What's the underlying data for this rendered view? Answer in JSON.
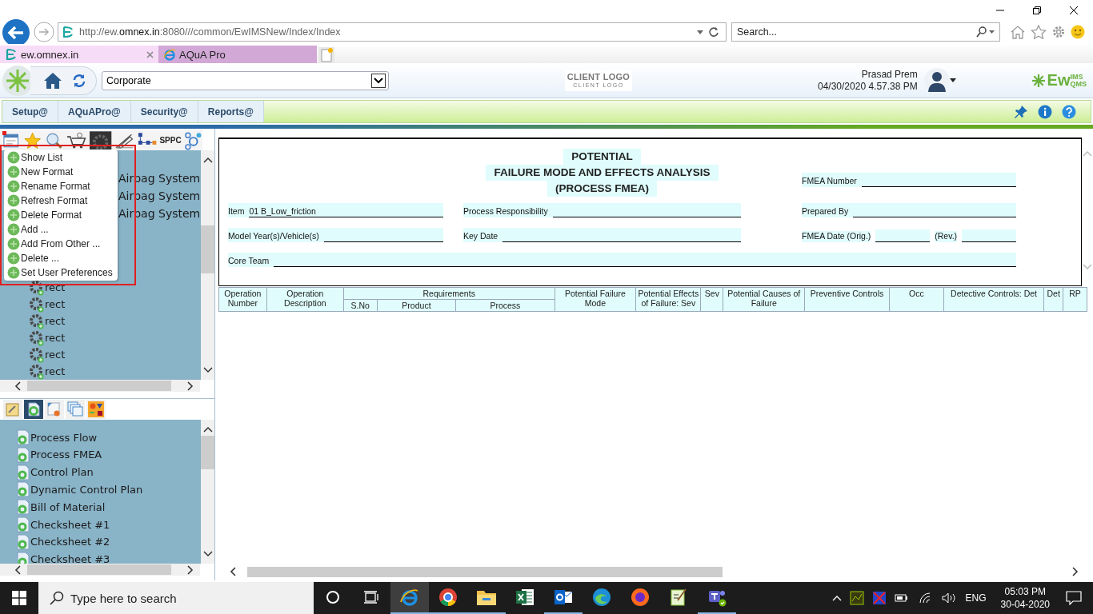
{
  "browser": {
    "url": "http://ew.**omnex.in**:8080///common/EwIMSNew/Index/Index",
    "search": {
      "placeholder": "Search..."
    },
    "tabs": [
      {
        "label": "ew.omnex.in",
        "selected": true
      },
      {
        "label": "AQuA Pro",
        "selected": false
      }
    ]
  },
  "header": {
    "location": "Corporate",
    "client_logo": "CLIENT LOGO",
    "client_logo_tagline": "CLIENT LOGO",
    "user_name": "Prasad Prem",
    "datetime": "04/30/2020 4.57.38 PM",
    "brand": "Ew",
    "brand_sup": "IMS",
    "brand_sub": "QMS"
  },
  "menu": [
    "Setup@",
    "AQuAPro@",
    "Security@",
    "Reports@"
  ],
  "tree": {
    "toolbar_label": "SPPC",
    "rows": [
      {
        "kind": "text",
        "label": "Airbag System"
      },
      {
        "kind": "text",
        "label": "Airbag System"
      },
      {
        "kind": "text",
        "label": "Airbag System"
      },
      {
        "kind": "gear",
        "label": "rect"
      },
      {
        "kind": "gear",
        "label": "rect"
      },
      {
        "kind": "gear",
        "label": "rect"
      },
      {
        "kind": "gear",
        "label": "rect"
      },
      {
        "kind": "gear",
        "label": "rect"
      },
      {
        "kind": "gear",
        "label": "rect"
      }
    ]
  },
  "context_menu": [
    "Show List",
    "New Format",
    "Rename Format",
    "Refresh Format",
    "Delete Format",
    "Add ...",
    "Add From Other ...",
    "Delete ...",
    "Set User Preferences"
  ],
  "templates": {
    "tabs": [
      {
        "kind": "notes",
        "selected": false
      },
      {
        "kind": "doc",
        "selected": true
      },
      {
        "kind": "certificate",
        "selected": false
      },
      {
        "kind": "sheets",
        "selected": false
      },
      {
        "kind": "shapes",
        "selected": false
      }
    ],
    "items": [
      "Process Flow",
      "Process FMEA",
      "Control Plan",
      "Dynamic Control Plan",
      "Bill of Material",
      "Checksheet #1",
      "Checksheet #2",
      "Checksheet #3"
    ]
  },
  "form": {
    "title": [
      "POTENTIAL",
      "FAILURE MODE AND EFFECTS ANALYSIS",
      "(PROCESS FMEA)"
    ],
    "fmea_number": "FMEA Number",
    "item": {
      "label": "Item",
      "value": "01 B_Low_friction"
    },
    "process_responsibility": "Process Responsibility",
    "prepared_by": "Prepared By",
    "model_year": "Model Year(s)/Vehicle(s)",
    "key_date": "Key Date",
    "fmea_date": "FMEA Date (Orig.)",
    "rev": "(Rev.)",
    "core_team": "Core Team"
  },
  "table": {
    "columns": [
      {
        "label": "Operation Number"
      },
      {
        "label": "Operation Description"
      },
      {
        "label": "Requirements",
        "children": [
          "S.No",
          "Product",
          "Process"
        ]
      },
      {
        "label": "Potential Failure Mode"
      },
      {
        "label": "Potential Effects of Failure: Sev"
      },
      {
        "label": "Sev"
      },
      {
        "label": "Potential Causes of Failure"
      },
      {
        "label": "Preventive Controls"
      },
      {
        "label": "Occ"
      },
      {
        "label": "Detective Controls: Det"
      },
      {
        "label": "Det"
      },
      {
        "label": "RP"
      }
    ]
  },
  "taskbar": {
    "search_placeholder": "Type here to search",
    "apps": [
      {
        "kind": "ie",
        "selected": true,
        "running": true
      },
      {
        "kind": "chrome",
        "selected": false,
        "running": true
      },
      {
        "kind": "folder",
        "selected": false,
        "running": true
      },
      {
        "kind": "excel",
        "selected": false,
        "running": false
      },
      {
        "kind": "outlook",
        "selected": false,
        "running": true
      },
      {
        "kind": "edge",
        "selected": false,
        "running": false
      },
      {
        "kind": "firefox",
        "selected": false,
        "running": false
      },
      {
        "kind": "notepad",
        "selected": false,
        "running": false
      },
      {
        "kind": "teams",
        "selected": false,
        "running": true
      }
    ],
    "language": "ENG",
    "time": "05:03 PM",
    "date": "30-04-2020"
  }
}
